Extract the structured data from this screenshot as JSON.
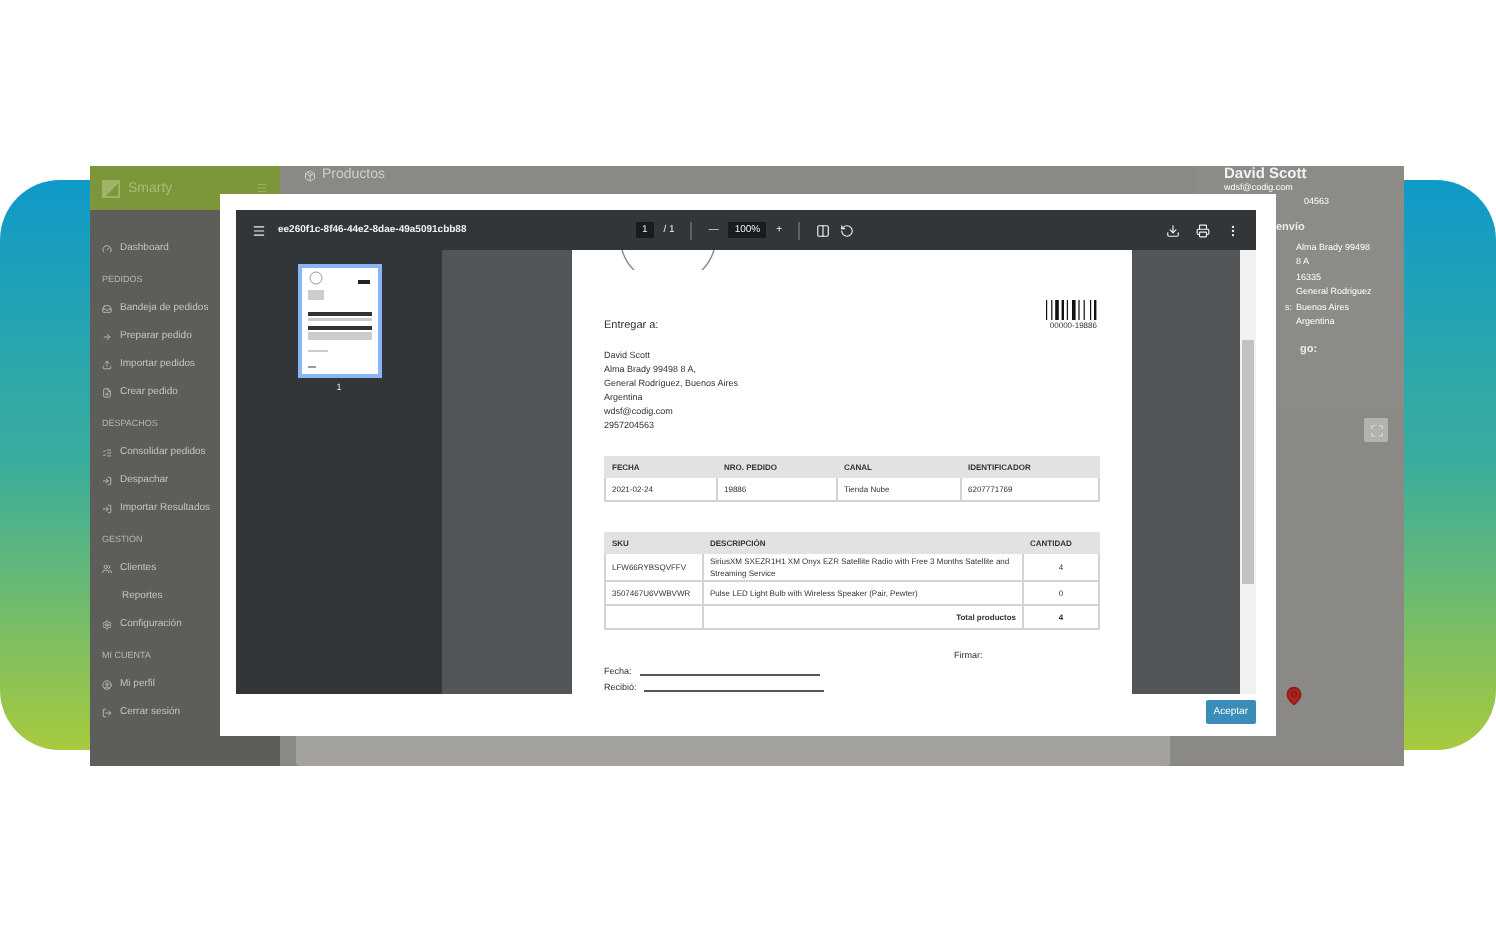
{
  "sidebar": {
    "brand": "Smarty",
    "items": [
      {
        "kind": "link",
        "label": "Dashboard"
      },
      {
        "kind": "section",
        "label": "PEDIDOS"
      },
      {
        "kind": "link",
        "label": "Bandeja de pedidos"
      },
      {
        "kind": "link",
        "label": "Preparar pedido"
      },
      {
        "kind": "link",
        "label": "Importar pedidos"
      },
      {
        "kind": "link",
        "label": "Crear pedido"
      },
      {
        "kind": "section",
        "label": "DESPACHOS"
      },
      {
        "kind": "link",
        "label": "Consolidar pedidos"
      },
      {
        "kind": "link",
        "label": "Despachar"
      },
      {
        "kind": "link",
        "label": "Importar Resultados"
      },
      {
        "kind": "section",
        "label": "GESTIÓN"
      },
      {
        "kind": "link",
        "label": "Clientes"
      },
      {
        "kind": "sublink",
        "label": "Reportes"
      },
      {
        "kind": "link",
        "label": "Configuración"
      },
      {
        "kind": "section",
        "label": "MI CUENTA"
      },
      {
        "kind": "link",
        "label": "Mi perfil"
      },
      {
        "kind": "link",
        "label": "Cerrar sesión"
      }
    ]
  },
  "page_header": {
    "title": "Productos"
  },
  "customer": {
    "name": "David Scott",
    "email": "wdsf@codig.com",
    "phone": "04563",
    "shipping_heading": "envío",
    "rows": [
      {
        "value": "Alma Brady 99498"
      },
      {
        "value": "8 A"
      },
      {
        "value": "16335"
      },
      {
        "value": "General Rodriguez"
      },
      {
        "label": "s:",
        "value": "Buenos Aires"
      },
      {
        "value": "Argentina"
      }
    ],
    "next_heading": "go:"
  },
  "modal": {
    "viewer": {
      "filename": "ee260f1c-8f46-44e2-8dae-49a5091cbb88",
      "page": "1",
      "pages": "/ 1",
      "zoom_out": "—",
      "zoom": "100%",
      "zoom_in": "+",
      "thumbnail_label": "1"
    },
    "document": {
      "barcode_number": "00000-19886",
      "deliver_to": "Entregar a:",
      "address": [
        "David Scott",
        "Alma Brady 99498 8 A,",
        "General Rodríguez, Buenos Aires",
        "Argentina",
        "wdsf@codig.com",
        "2957204563"
      ],
      "order_table": {
        "columns": [
          "FECHA",
          "NRO. PEDIDO",
          "CANAL",
          "IDENTIFICADOR"
        ],
        "rows": [
          [
            "2021-02-24",
            "19886",
            "Tienda Nube",
            "6207771769"
          ]
        ]
      },
      "items_table": {
        "columns": [
          "SKU",
          "DESCRIPCIÓN",
          "CANTIDAD"
        ],
        "rows": [
          [
            "LFW66RYBSQVFFV",
            "SiriusXM SXEZR1H1 XM Onyx EZR Satellite Radio with Free 3 Months Satellite and Streaming Service",
            "4"
          ],
          [
            "3507467U6VWBVWR",
            "Pulse LED Light Bulb with Wireless Speaker (Pair, Pewter)",
            "0"
          ]
        ],
        "total_label": "Total productos",
        "total": "4"
      },
      "sign_label": "Firmar:",
      "fields": [
        "Fecha:",
        "Recibió:"
      ]
    },
    "accept_button": "Aceptar"
  }
}
